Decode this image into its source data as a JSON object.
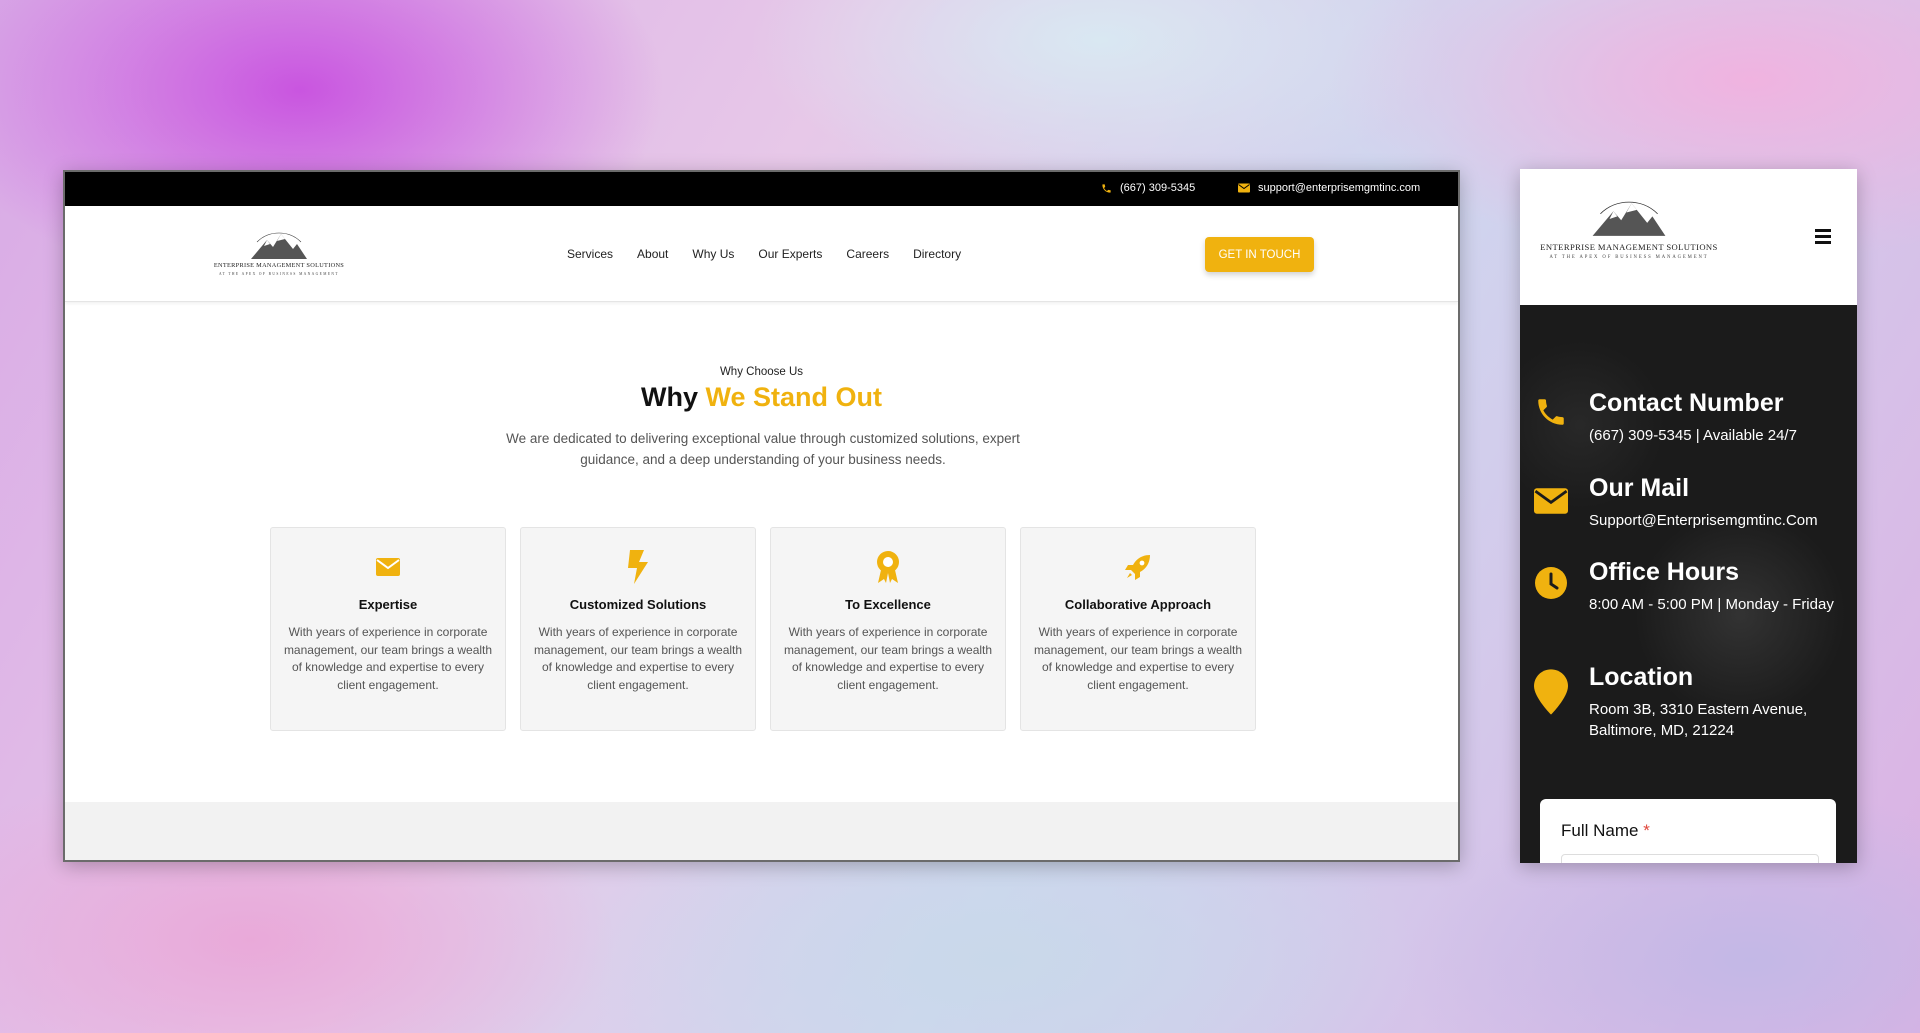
{
  "desktop": {
    "topbar": {
      "phone": "(667) 309-5345",
      "email": "support@enterprisemgmtinc.com"
    },
    "logo": {
      "brand": "ENTERPRISE MANAGEMENT SOLUTIONS",
      "tagline": "AT THE APEX OF BUSINESS MANAGEMENT"
    },
    "nav": [
      "Services",
      "About",
      "Why Us",
      "Our Experts",
      "Careers",
      "Directory"
    ],
    "cta": "GET IN TOUCH",
    "section": {
      "eyebrow": "Why Choose Us",
      "heading_plain": "Why",
      "heading_highlight": "We Stand Out",
      "lead": "We are dedicated to delivering exceptional value through customized solutions, expert guidance, and a deep understanding of your business needs."
    },
    "cards": [
      {
        "icon": "envelope-icon",
        "title": "Expertise",
        "desc": "With years of experience in corporate management, our team brings a wealth of knowledge and expertise to every client engagement."
      },
      {
        "icon": "bolt-icon",
        "title": "Customized Solutions",
        "desc": "With years of experience in corporate management, our team brings a wealth of knowledge and expertise to every client engagement."
      },
      {
        "icon": "award-icon",
        "title": "To Excellence",
        "desc": "With years of experience in corporate management, our team brings a wealth of knowledge and expertise to every client engagement."
      },
      {
        "icon": "rocket-icon",
        "title": "Collaborative Approach",
        "desc": "With years of experience in corporate management, our team brings a wealth of knowledge and expertise to every client engagement."
      }
    ]
  },
  "mobile": {
    "logo": {
      "brand": "ENTERPRISE MANAGEMENT SOLUTIONS",
      "tagline": "AT THE APEX OF BUSINESS MANAGEMENT"
    },
    "contacts": [
      {
        "icon": "phone-icon",
        "title": "Contact Number",
        "value": "(667) 309-5345 | Available 24/7"
      },
      {
        "icon": "envelope-icon",
        "title": "Our Mail",
        "value": "Support@Enterprisemgmtinc.Com"
      },
      {
        "icon": "clock-icon",
        "title": "Office Hours",
        "value": "8:00 AM - 5:00 PM | Monday - Friday"
      },
      {
        "icon": "location-pin-icon",
        "title": "Location",
        "value": "Room 3B, 3310 Eastern Avenue, Baltimore, MD, 21224"
      }
    ],
    "form": {
      "full_name_label": "Full Name",
      "required_mark": "*"
    }
  },
  "colors": {
    "accent": "#f0b20f",
    "topbar": "#000000",
    "mobile_panel": "#1b1b1b"
  }
}
